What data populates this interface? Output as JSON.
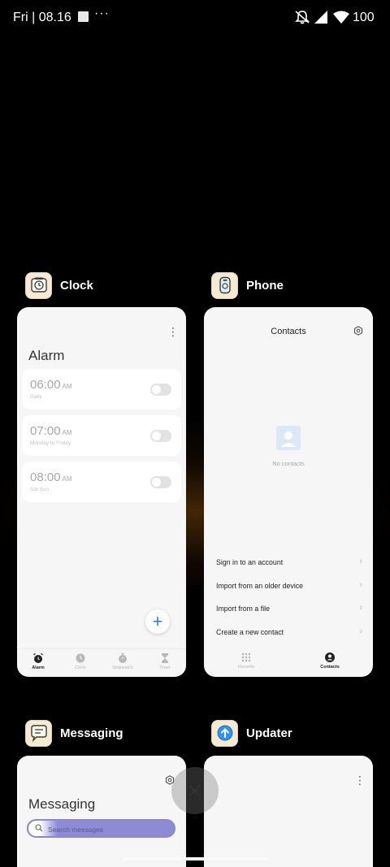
{
  "status_bar": {
    "time": "Fri | 08.16",
    "more": "···",
    "battery": "100",
    "icons": [
      "notification-square-icon",
      "mute-icon",
      "signal-icon",
      "wifi-icon"
    ]
  },
  "apps": [
    {
      "name": "Clock",
      "icon": "clock-app-icon",
      "screen": {
        "title": "Alarm",
        "alarms": [
          {
            "time": "06:00",
            "ampm": "AM",
            "repeat": "Daily",
            "enabled": false
          },
          {
            "time": "07:00",
            "ampm": "AM",
            "repeat": "Monday to Friday",
            "enabled": false
          },
          {
            "time": "08:00",
            "ampm": "AM",
            "repeat": "Sat Sun",
            "enabled": false
          }
        ],
        "fab": "+",
        "nav": [
          "Alarm",
          "Clock",
          "Stopwatch",
          "Timer"
        ],
        "active_nav": "Alarm"
      }
    },
    {
      "name": "Phone",
      "icon": "phone-app-icon",
      "screen": {
        "title": "Contacts",
        "empty_text": "No contacts",
        "actions": [
          "Sign in to an account",
          "Import from an older device",
          "Import from a file",
          "Create a new contact"
        ],
        "nav": [
          "Recents",
          "Contacts"
        ],
        "active_nav": "Contacts"
      }
    },
    {
      "name": "Messaging",
      "icon": "messaging-app-icon",
      "screen": {
        "title": "Messaging",
        "search_placeholder": "Search messages"
      }
    },
    {
      "name": "Updater",
      "icon": "updater-app-icon",
      "screen": {}
    }
  ],
  "colors": {
    "accent_blue": "#2b7df0",
    "icon_bg": "#f7ead2",
    "search_purple": "#8f8ad4"
  }
}
